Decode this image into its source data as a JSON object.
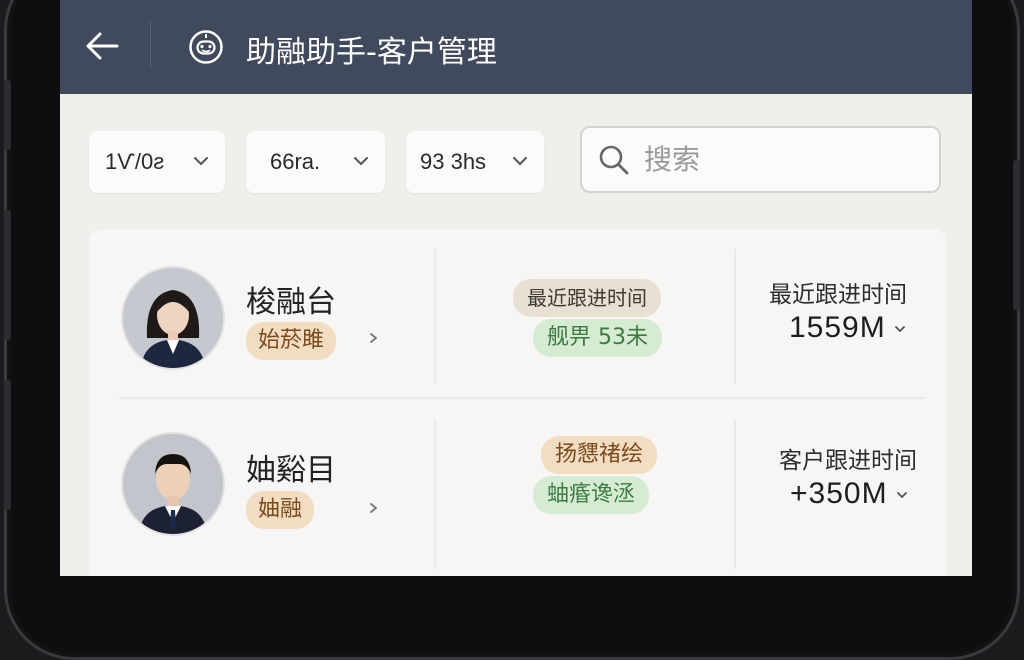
{
  "header": {
    "title": "助融助手-客户管理"
  },
  "filters": [
    {
      "label": "1Ѵ/0ƨ"
    },
    {
      "label": "66ra. "
    },
    {
      "label": "93 3hs"
    }
  ],
  "search": {
    "placeholder": "搜索"
  },
  "customers": [
    {
      "name": "梭融台",
      "tag": "始菸雎",
      "status_tag": "最近跟进时间",
      "status_green": "舰畀 53未",
      "meta_label": "最近跟进时间",
      "meta_value": "1559M"
    },
    {
      "name": "妯谿目",
      "tag": "妯融",
      "status_tag": "扬㦟禇绘",
      "status_green": "蚰痻谗洆",
      "meta_label": "客户跟进时间",
      "meta_value": "+350M"
    }
  ],
  "colors": {
    "header_bg": "#41495d",
    "tag_orange_bg": "#f2dcc2",
    "tag_green_bg": "#d6ecd2"
  }
}
